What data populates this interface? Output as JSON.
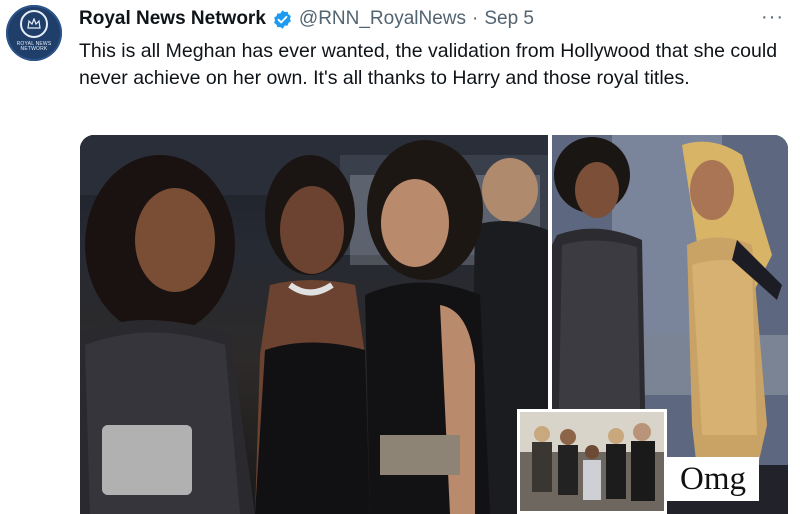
{
  "account": {
    "display_name": "Royal News Network",
    "handle": "@RNN_RoyalNews",
    "separator": "·",
    "date": "Sep 5",
    "avatar_text": "ROYAL NEWS NETWORK",
    "verified_color": "#1d9bf0"
  },
  "tweet": {
    "text": "This is all Meghan has ever wanted, the validation from Hollywood that she could never achieve on her own. It's all thanks to Harry and those royal titles.",
    "more_label": "···"
  },
  "media": {
    "caption_overlay": "Omg"
  },
  "colors": {
    "text_primary": "#0f1419",
    "text_secondary": "#536471",
    "avatar_bg": "#1f3f6a"
  }
}
